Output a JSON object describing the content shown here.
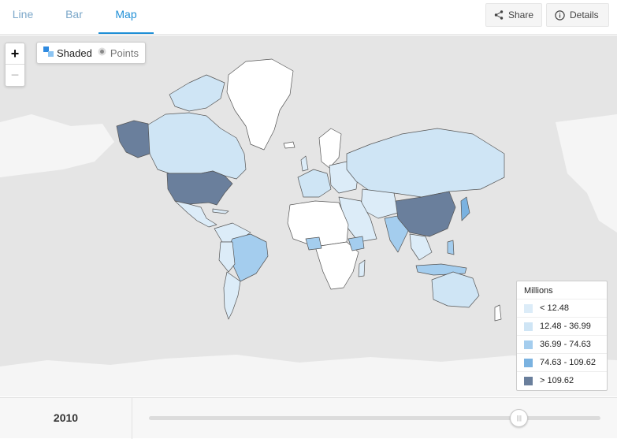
{
  "tabs": [
    {
      "label": "Line",
      "active": false
    },
    {
      "label": "Bar",
      "active": false
    },
    {
      "label": "Map",
      "active": true
    }
  ],
  "toolbar": {
    "share_label": "Share",
    "details_label": "Details"
  },
  "map_controls": {
    "zoom_in": "+",
    "zoom_out": "−",
    "shaded_label": "Shaded",
    "points_label": "Points",
    "selected_mode": "Shaded"
  },
  "legend": {
    "title": "Millions",
    "items": [
      {
        "label": "< 12.48",
        "color": "#dcecf8"
      },
      {
        "label": "12.48 - 36.99",
        "color": "#cfe5f5"
      },
      {
        "label": "36.99 - 74.63",
        "color": "#a4cdee"
      },
      {
        "label": "74.63 - 109.62",
        "color": "#7ab2e0"
      },
      {
        "label": "> 109.62",
        "color": "#6a7f9c"
      }
    ]
  },
  "timeline": {
    "year": "2010",
    "position": 0.82
  },
  "colors": {
    "accent": "#1f8fd6",
    "ocean": "#e5e5e5",
    "land_nodata": "#f5f5f5",
    "land_white": "#ffffff"
  }
}
